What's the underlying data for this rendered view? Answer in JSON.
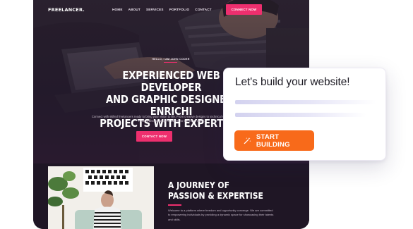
{
  "site": {
    "logo": "FREELANCER.",
    "nav": [
      "HOME",
      "ABOUT",
      "SERVICES",
      "PORTFOLIO",
      "CONTACT"
    ],
    "nav_button": "CONNECT NOW"
  },
  "hero": {
    "greeting": "HELLO, I AM JOHN CODER",
    "headline": "EXPERIENCED WEB DEVELOPER\nAND GRAPHIC DESIGNER, ENRICHI\nPROJECTS WITH EXPERTISE.",
    "subtext": "Connect with skilled freelancers ready to bring your vision to life. From creative designs to technical solutions, our platform hosts a diverse range of talents to suit every need.",
    "button": "CONTACT NOW"
  },
  "about": {
    "title": "A JOURNEY OF\nPASSION & EXPERTISE",
    "text": "Welcome to a platform where freedom and opportunity converge. We are committed to empowering individuals by providing a dynamic space for showcasing their talents and skills."
  },
  "card": {
    "title": "Let's build your website!",
    "button": "START BUILDING",
    "button_icon": "magic-wand-icon"
  },
  "colors": {
    "accent_pink": "#ee2f6e",
    "accent_orange": "#f86a1a",
    "dark_bg": "#1c1423"
  }
}
